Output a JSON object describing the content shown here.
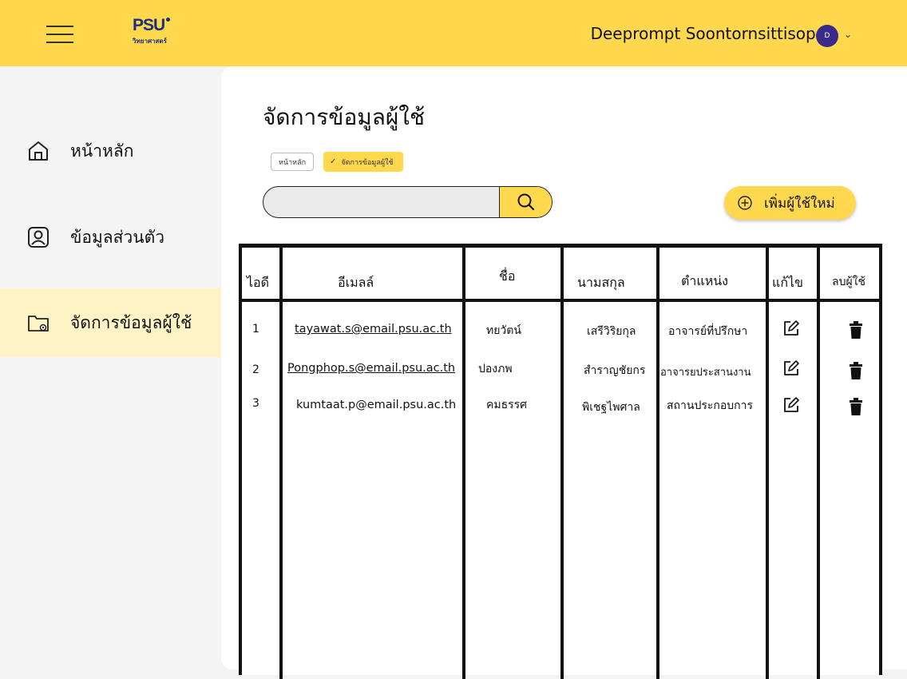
{
  "header": {
    "logo_text": "PSU",
    "logo_sub": "วิทยาศาสตร์",
    "username": "Deeprompt Soontornsittisopa",
    "avatar_initial": "D",
    "accent_color": "#ffd84d"
  },
  "sidebar": {
    "items": [
      {
        "label": "หน้าหลัก",
        "icon": "home-icon"
      },
      {
        "label": "ข้อมูลส่วนตัว",
        "icon": "user-profile-icon"
      },
      {
        "label": "จัดการข้อมูลผู้ใช้",
        "icon": "folder-settings-icon",
        "active": true
      }
    ]
  },
  "main": {
    "title": "จัดการข้อมูลผู้ใช้",
    "breadcrumb": [
      "หน้าหลัก",
      "จัดการข้อมูลผู้ใช้"
    ],
    "search_placeholder": "",
    "add_button": "เพิ่มผู้ใช้ใหม่"
  },
  "table": {
    "headers": [
      "ไอดี",
      "อีเมลล์",
      "ชื่อ",
      "นามสกุล",
      "ตำแหน่ง",
      "แก้ไข",
      "ลบผู้ใช้"
    ],
    "rows": [
      {
        "id": "1",
        "email": "tayawat.s@email.psu.ac.th",
        "first": "ทยวัตน์",
        "last": "เสรีวิริยกุล",
        "position": "อาจารย์ที่ปรึกษา"
      },
      {
        "id": "2",
        "email": "Pongphop.s@email.psu.ac.th",
        "first": "ปองภพ",
        "last": "สำราญชัยกร",
        "position": "อาจารยประสานงาน"
      },
      {
        "id": "3",
        "email": "kumtaat.p@email.psu.ac.th",
        "first": "คมธรรศ",
        "last": "พิเชฐไพศาล",
        "position": "สถานประกอบการ"
      }
    ]
  }
}
